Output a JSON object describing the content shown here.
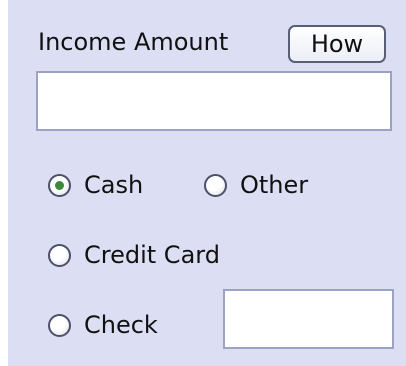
{
  "income": {
    "label": "Income Amount",
    "how_button": "How",
    "amount_value": ""
  },
  "payment_methods": {
    "cash": {
      "label": "Cash",
      "selected": true
    },
    "other": {
      "label": "Other",
      "selected": false
    },
    "credit_card": {
      "label": "Credit Card",
      "selected": false
    },
    "check": {
      "label": "Check",
      "selected": false,
      "number_value": ""
    }
  },
  "colors": {
    "panel_background": "#dcdff3",
    "selected_dot": "#3a8a3a",
    "field_border": "#9ca2c2"
  }
}
